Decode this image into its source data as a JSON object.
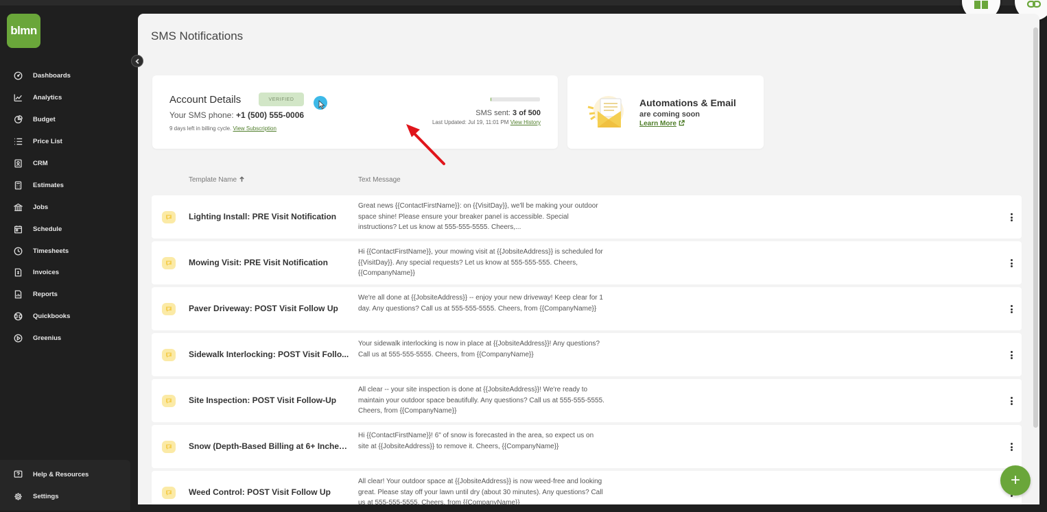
{
  "brand": {
    "logo_text": "blmn",
    "accent": "#6aa63a"
  },
  "sidebar": {
    "items": [
      {
        "label": "Dashboards",
        "icon": "gauge-icon"
      },
      {
        "label": "Analytics",
        "icon": "line-chart-icon"
      },
      {
        "label": "Budget",
        "icon": "pie-chart-icon"
      },
      {
        "label": "Price List",
        "icon": "list-icon"
      },
      {
        "label": "CRM",
        "icon": "contact-card-icon"
      },
      {
        "label": "Estimates",
        "icon": "calculator-icon"
      },
      {
        "label": "Jobs",
        "icon": "building-icon"
      },
      {
        "label": "Schedule",
        "icon": "calendar-icon"
      },
      {
        "label": "Timesheets",
        "icon": "clock-icon"
      },
      {
        "label": "Invoices",
        "icon": "invoice-icon"
      },
      {
        "label": "Reports",
        "icon": "report-icon"
      },
      {
        "label": "Quickbooks",
        "icon": "quickbooks-icon"
      },
      {
        "label": "Greenius",
        "icon": "play-circle-icon"
      }
    ],
    "bottom": [
      {
        "label": "Help & Resources",
        "icon": "help-icon"
      },
      {
        "label": "Settings",
        "icon": "gear-icon"
      }
    ]
  },
  "page": {
    "title": "SMS Notifications"
  },
  "account": {
    "title": "Account Details",
    "badge": "VERIFIED",
    "phone_label": "Your SMS phone: ",
    "phone": "+1 (500) 555-0006",
    "billing_text": "9 days left in billing cycle. ",
    "billing_link": "View Subscription",
    "sent_label": "SMS sent: ",
    "sent_value": "3 of 500",
    "sent_fraction": 0.006,
    "last_updated": "Last Updated: Jul 19, 11:01 PM ",
    "history_link": "View History"
  },
  "automations": {
    "title": "Automations & Email",
    "subtitle": "are coming soon",
    "link": "Learn More"
  },
  "table": {
    "columns": {
      "name": "Template Name",
      "message": "Text Message"
    },
    "rows": [
      {
        "name": "Lighting Install: PRE Visit Notification",
        "message": "Great news {{ContactFirstName}}: on {{VisitDay}}, we'll be making your outdoor space shine! Please ensure your breaker panel is accessible. Special instructions? Let us know at 555-555-5555. Cheers,..."
      },
      {
        "name": "Mowing Visit: PRE Visit Notification",
        "message": "Hi {{ContactFirstName}}, your mowing visit at {{JobsiteAddress}} is scheduled for {{VisitDay}}. Any special requests? Let us know at 555-555-555. Cheers, {{CompanyName}}"
      },
      {
        "name": "Paver Driveway: POST Visit Follow Up",
        "message": "We're all done at {{JobsiteAddress}} -- enjoy your new driveway! Keep clear for 1 day. Any questions? Call us at 555-555-5555. Cheers, from {{CompanyName}}"
      },
      {
        "name": "Sidewalk Interlocking: POST Visit Follo...",
        "message": "Your sidewalk interlocking is now in place at {{JobsiteAddress}}! Any questions? Call us at 555-555-5555. Cheers, from {{CompanyName}}"
      },
      {
        "name": "Site Inspection: POST Visit Follow-Up",
        "message": "All clear -- your site inspection is done at {{JobsiteAddress}}! We're ready to maintain your outdoor space beautifully. Any questions? Call us at 555-555-5555. Cheers, from {{CompanyName}}"
      },
      {
        "name": "Snow (Depth-Based Billing at 6+ Inches...",
        "message": "Hi {{ContactFirstName}}! 6\" of snow is forecasted in the area, so expect us on site at {{JobsiteAddress}} to remove it. Cheers, {{CompanyName}}"
      },
      {
        "name": "Weed Control: POST Visit Follow Up",
        "message": "All clear! Your outdoor space at {{JobsiteAddress}} is now weed-free and looking great. Please stay off your lawn until dry (about 30 minutes). Any questions? Call us at 555-555-5555. Cheers, from {{CompanyName}}"
      }
    ]
  },
  "fab": {
    "label": "+"
  }
}
